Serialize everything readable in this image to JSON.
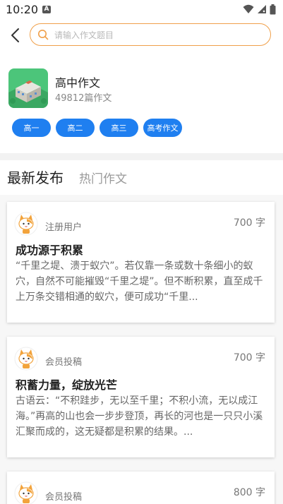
{
  "status_bar": {
    "time": "10:20",
    "notification_letter": "A"
  },
  "search": {
    "placeholder": "请输入作文题目"
  },
  "category": {
    "title": "高中作文",
    "count": "49812篇作文"
  },
  "grades": [
    "高一",
    "高二",
    "高三",
    "高考作文"
  ],
  "tabs": {
    "latest": "最新发布",
    "popular": "热门作文"
  },
  "accent_color": "#1f7ff0",
  "search_border_color": "#f0a04a",
  "essays": [
    {
      "author": "注册用户",
      "words": "700 字",
      "title": "成功源于积累",
      "excerpt": "“千里之堤、溃于蚁穴”。若仅靠一条或数十条细小的蚁穴，自然不可能摧毁“千里之堤”。但不断积累，直至成千上万条交错相通的蚁穴，便可成功“千里..."
    },
    {
      "author": "会员投稿",
      "words": "700 字",
      "title": "积蓄力量，绽放光芒",
      "excerpt": "古语云：“不积跬步，无以至千里；不积小流，无以成江海。”再高的山也会一步步登顶，再长的河也是一只只小溪汇聚而成的，这无疑都是积累的结果。..."
    },
    {
      "author": "会员投稿",
      "words": "800 字",
      "title": "",
      "excerpt": ""
    }
  ]
}
